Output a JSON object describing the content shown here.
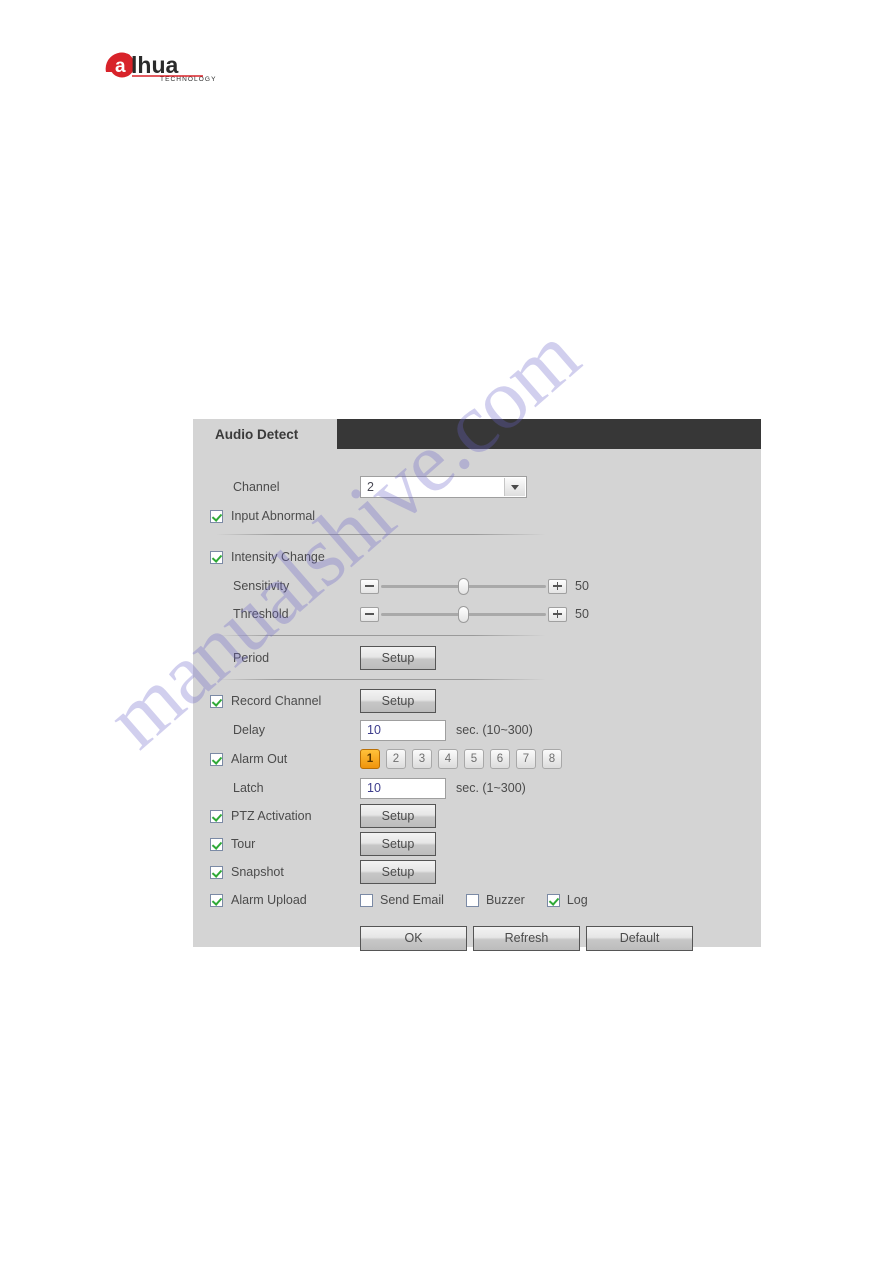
{
  "brand": {
    "logo_name": "dahua",
    "logo_sub": "TECHNOLOGY"
  },
  "watermark": {
    "text": "manualshive.com"
  },
  "panel": {
    "tab": {
      "label": "Audio Detect"
    },
    "channel": {
      "label": "Channel",
      "value": "2"
    },
    "input_abnormal": {
      "label": "Input Abnormal",
      "checked": true
    },
    "intensity_change": {
      "label": "Intensity Change",
      "checked": true
    },
    "sensitivity": {
      "label": "Sensitivity",
      "value": "50",
      "minus": "-",
      "plus": "+",
      "percent": 50
    },
    "threshold": {
      "label": "Threshold",
      "value": "50",
      "minus": "-",
      "plus": "+",
      "percent": 50
    },
    "period": {
      "label": "Period",
      "button": "Setup"
    },
    "record_channel": {
      "label": "Record Channel",
      "checked": true,
      "button": "Setup"
    },
    "delay": {
      "label": "Delay",
      "value": "10",
      "unit": "sec. (10~300)"
    },
    "alarm_out": {
      "label": "Alarm Out",
      "checked": true,
      "buttons": [
        "1",
        "2",
        "3",
        "4",
        "5",
        "6",
        "7",
        "8"
      ],
      "selected": "1"
    },
    "latch": {
      "label": "Latch",
      "value": "10",
      "unit": "sec. (1~300)"
    },
    "ptz_activation": {
      "label": "PTZ Activation",
      "checked": true,
      "button": "Setup"
    },
    "tour": {
      "label": "Tour",
      "checked": true,
      "button": "Setup"
    },
    "snapshot": {
      "label": "Snapshot",
      "checked": true,
      "button": "Setup"
    },
    "alarm_upload": {
      "label": "Alarm Upload",
      "checked": true,
      "options": [
        {
          "label": "Send Email",
          "checked": false
        },
        {
          "label": "Buzzer",
          "checked": false
        },
        {
          "label": "Log",
          "checked": true
        }
      ]
    },
    "actions": {
      "ok": "OK",
      "refresh": "Refresh",
      "default": "Default"
    },
    "colors": {
      "panel_bg": "#d4d4d4",
      "tabbar_bg": "#373737",
      "check_green": "#2faa37",
      "alarm_selected": "#f0940c",
      "input_text": "#3d3d8c",
      "watermark": "#6a63c8"
    }
  }
}
